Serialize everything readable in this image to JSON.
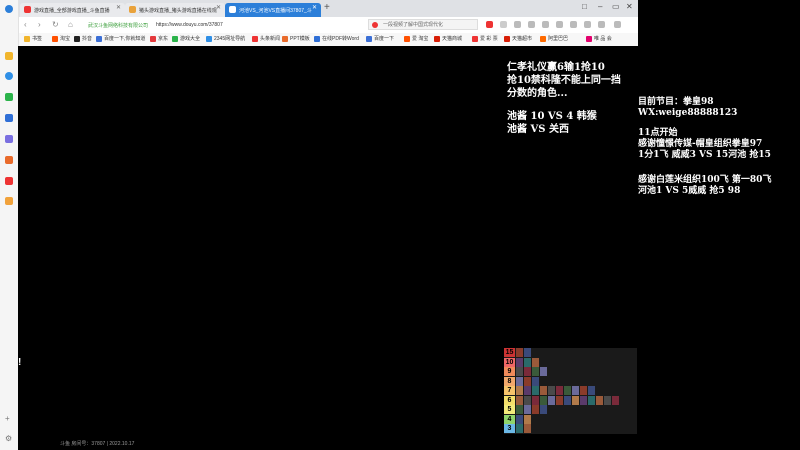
{
  "browser": {
    "tabs": [
      {
        "label": "游戏直播_全部游戏直播_斗鱼直播",
        "active": false,
        "color": "#e33"
      },
      {
        "label": "猪头游戏直播_猪头游戏直播在线观",
        "active": false,
        "color": "#e9a23b"
      },
      {
        "label": "河池VS_河池VS直播间37807_斗",
        "active": true,
        "color": "#fff"
      }
    ],
    "new_tab": "+",
    "window_controls": [
      "□",
      "–",
      "▭",
      "✕"
    ],
    "nav": {
      "back": "‹",
      "forward": "›",
      "reload": "↻",
      "home": "⌂"
    },
    "address": {
      "site": "武汉斗鱼网络科技有限公司",
      "url": "https://www.douyu.com/37807"
    },
    "search": {
      "placeholder": "一段视频了解中国式现代化"
    },
    "bookmarks": [
      {
        "label": "书签",
        "color": "#f1b52c"
      },
      {
        "label": "淘宝",
        "color": "#ff5000"
      },
      {
        "label": "抖音",
        "color": "#222"
      },
      {
        "label": "百度一下,你就知道",
        "color": "#3b6fd6"
      },
      {
        "label": "京东",
        "color": "#e4393c"
      },
      {
        "label": "游戏大全",
        "color": "#2bb34a"
      },
      {
        "label": "2345网址导航",
        "color": "#2f8fe6"
      },
      {
        "label": "头条新闻",
        "color": "#e33"
      },
      {
        "label": "PPT模板",
        "color": "#e96b2b"
      },
      {
        "label": "在线PDF转Word",
        "color": "#2f6fd6"
      },
      {
        "label": "百度一下",
        "color": "#3b6fd6"
      },
      {
        "label": "爱 淘宝",
        "color": "#ff5000"
      },
      {
        "label": "天猫商城",
        "color": "#d81e06"
      },
      {
        "label": "爱 彩 票",
        "color": "#e33"
      },
      {
        "label": "天猫超市",
        "color": "#d81e06"
      },
      {
        "label": "阿里巴巴",
        "color": "#ff6a00"
      },
      {
        "label": "唯 品 会",
        "color": "#e3006d"
      }
    ]
  },
  "sidebar": {
    "icons": [
      {
        "name": "browser-logo-icon",
        "color": "#2c7fd9"
      },
      {
        "name": "favorites-icon",
        "color": "#f1b52c"
      },
      {
        "name": "speed-icon",
        "color": "#2f8fe6"
      },
      {
        "name": "wechat-icon",
        "color": "#2bb34a"
      },
      {
        "name": "download-icon",
        "color": "#2f6fd6"
      },
      {
        "name": "apps-icon",
        "color": "#7a6fe0"
      },
      {
        "name": "weibo-icon",
        "color": "#e96b2b"
      },
      {
        "name": "pdf-icon",
        "color": "#e33"
      },
      {
        "name": "game-icon",
        "color": "#f1a23b"
      }
    ],
    "bottom": [
      "+",
      "⚙"
    ]
  },
  "overlay": {
    "block1": "仁孝礼仪赢6输1抢10\n抢10禁科隆不能上同一挡\n分数的角色...",
    "block2": "池酱 10 VS 4 韩猴\n池酱 VS 关西",
    "block3": "目前节目：拳皇98\nWX:weige88888123",
    "block4": "11点开始\n感谢憧憬传媒-帽皇组织拳皇97\n1分1飞 威威3 VS 15河池 抢15",
    "block5": "感谢白莲米组织100飞 第一80飞\n河池1 VS 5威威 抢5 98",
    "exclaim": "!"
  },
  "tier_list": {
    "rows": [
      {
        "label": "15",
        "color": "#c33",
        "count": 2
      },
      {
        "label": "10",
        "color": "#e66",
        "count": 3
      },
      {
        "label": "9",
        "color": "#f08a5a",
        "count": 4
      },
      {
        "label": "8",
        "color": "#f2a86b",
        "count": 3
      },
      {
        "label": "7",
        "color": "#f6c46b",
        "count": 10
      },
      {
        "label": "6",
        "color": "#f4df6b",
        "count": 13
      },
      {
        "label": "5",
        "color": "#f2ea7a",
        "count": 4
      },
      {
        "label": "4",
        "color": "#8fd46b",
        "count": 2
      },
      {
        "label": "3",
        "color": "#6bb8e6",
        "count": 2
      }
    ]
  },
  "footer": {
    "text": "斗鱼 房间号：37807 | 2022.10.17"
  }
}
